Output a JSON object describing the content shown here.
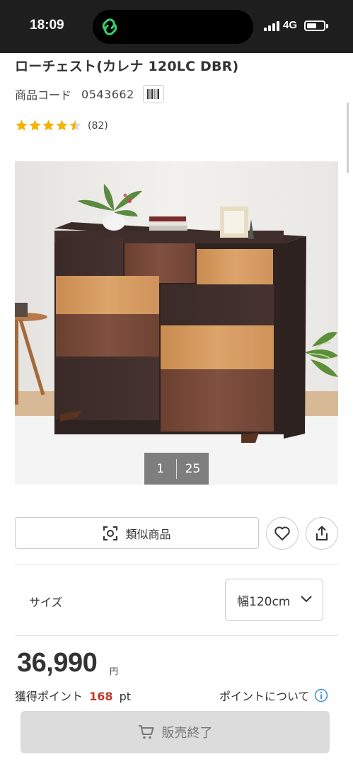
{
  "status_bar": {
    "time": "18:09",
    "network": "4G",
    "battery_level": 0.6
  },
  "product": {
    "title": "ローチェスト(カレナ 120LC DBR)",
    "code_label": "商品コード",
    "code_value": "0543662",
    "rating_value": 4.5,
    "review_count": "(82)",
    "image_current": "1",
    "image_total": "25"
  },
  "actions": {
    "similar_label": "類似商品"
  },
  "size": {
    "label": "サイズ",
    "selected": "幅120cm"
  },
  "price": {
    "amount": "36,990",
    "currency": "円"
  },
  "points": {
    "label": "獲得ポイント",
    "value": "168",
    "unit": "pt",
    "about_label": "ポイントについて"
  },
  "cart": {
    "status_label": "販売終了"
  },
  "colors": {
    "star": "#f5b301",
    "points_value": "#c0392b",
    "info_blue": "#3a8fd6",
    "soldout_bg": "#dcdcdc",
    "status_bar_bg": "#1e1e1e"
  }
}
